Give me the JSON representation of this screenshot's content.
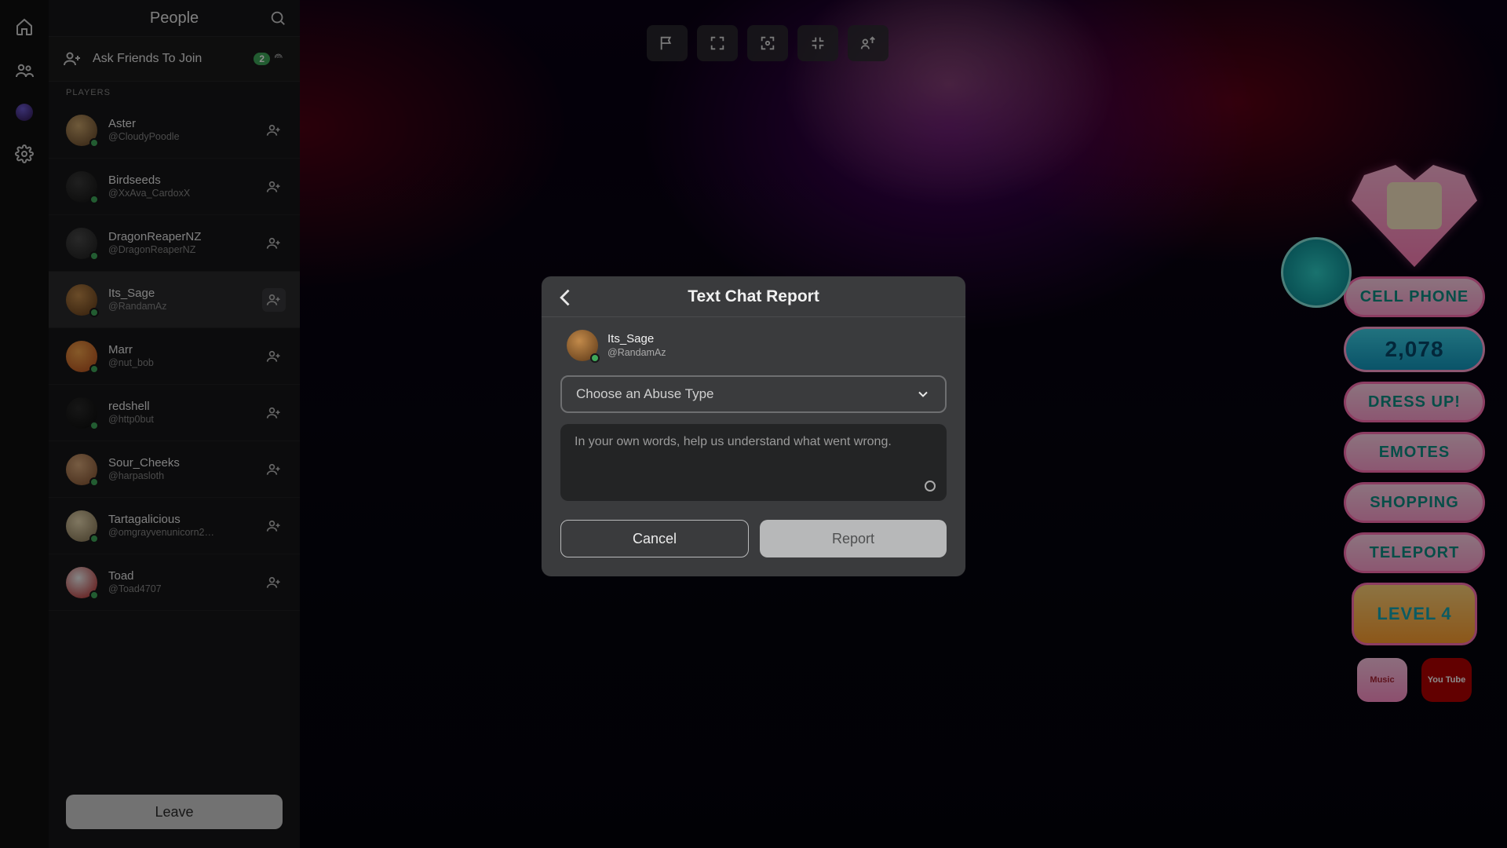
{
  "left_rail": {
    "icons": [
      "home-icon",
      "people-icon",
      "avatar-icon",
      "settings-icon"
    ]
  },
  "people": {
    "title": "People",
    "ask_label": "Ask Friends To Join",
    "ask_count": "2",
    "players_heading": "PLAYERS",
    "leave_label": "Leave",
    "list": [
      {
        "display": "Aster",
        "user": "@CloudyPoodle",
        "selected": false
      },
      {
        "display": "Birdseeds",
        "user": "@XxAva_CardoxX",
        "selected": false
      },
      {
        "display": "DragonReaperNZ",
        "user": "@DragonReaperNZ",
        "selected": false
      },
      {
        "display": "Its_Sage",
        "user": "@RandamAz",
        "selected": true
      },
      {
        "display": "Marr",
        "user": "@nut_bob",
        "selected": false
      },
      {
        "display": "redshell",
        "user": "@http0but",
        "selected": false
      },
      {
        "display": "Sour_Cheeks",
        "user": "@harpasloth",
        "selected": false
      },
      {
        "display": "Tartagalicious",
        "user": "@omgrayvenunicorn2…",
        "selected": false
      },
      {
        "display": "Toad",
        "user": "@Toad4707",
        "selected": false
      }
    ]
  },
  "toolbar": {
    "buttons": [
      "flag-icon",
      "fullscreen-enter-icon",
      "fullscreen-frame-icon",
      "fullscreen-exit-icon",
      "respawn-icon"
    ]
  },
  "hud": {
    "cell_phone": "CELL PHONE",
    "currency": "2,078",
    "dress_up": "DRESS UP!",
    "emotes": "EMOTES",
    "shopping": "SHOPPING",
    "teleport": "TELEPORT",
    "level_label": "LEVEL",
    "level_value": "4",
    "music": "Music",
    "youtube": "You\nTube"
  },
  "modal": {
    "title": "Text Chat Report",
    "user_display": "Its_Sage",
    "user_name": "@RandamAz",
    "select_placeholder": "Choose an Abuse Type",
    "text_placeholder": "In your own words, help us understand what went wrong.",
    "cancel": "Cancel",
    "report": "Report"
  }
}
